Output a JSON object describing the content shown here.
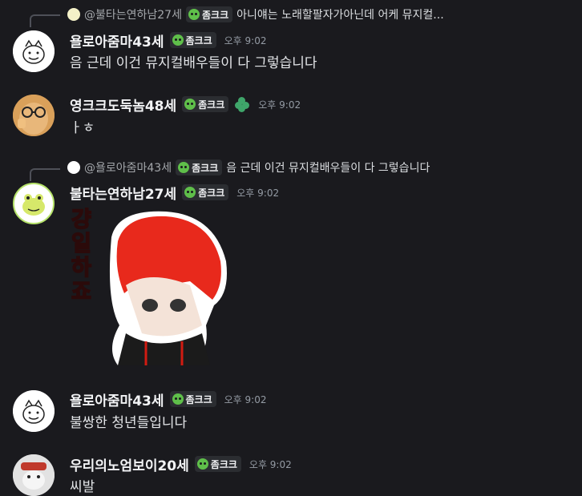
{
  "tag_label": "좀크크",
  "messages": [
    {
      "reply": {
        "name": "@불타는연하남27세",
        "tag": "좀크크",
        "text": "아니얘는 노래할팔자가아닌데 어케 뮤지컬..."
      },
      "user": "욜로아줌마43세",
      "time": "오후 9:02",
      "text": "음 근데 이건 뮤지컬배우들이 다 그렇습니다"
    },
    {
      "user": "영크크도둑놈48세",
      "time": "오후 9:02",
      "text": "ㅏㅎ"
    },
    {
      "reply": {
        "name": "@욜로아줌마43세",
        "tag": "좀크크",
        "text": "음 근데 이건 뮤지컬배우들이 다 그렇습니다"
      },
      "user": "불타는연하남27세",
      "time": "오후 9:02",
      "sticker_text": "걍일하죠"
    },
    {
      "user": "욜로아줌마43세",
      "time": "오후 9:02",
      "text": "불쌍한 청년들입니다"
    },
    {
      "user": "우리의노엄보이20세",
      "time": "오후 9:02",
      "text": "씨발"
    }
  ]
}
